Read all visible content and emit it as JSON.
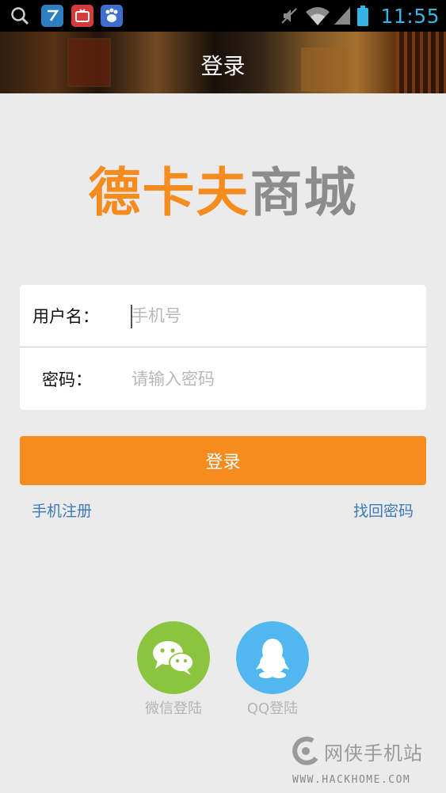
{
  "status_bar": {
    "time": "11:55",
    "icons": [
      "search-icon",
      "app-icon-1",
      "tv-app-icon",
      "baidu-icon",
      "mute-icon",
      "wifi-icon",
      "signal-icon",
      "battery-icon"
    ],
    "clock_color": "#34b5e5"
  },
  "header": {
    "title": "登录"
  },
  "logo": {
    "part1": "德卡夫",
    "part2": "商城",
    "color_primary": "#f68b1e",
    "color_secondary": "#8c8c8c"
  },
  "form": {
    "username_label": "用户名：",
    "username_placeholder": "手机号",
    "username_value": "",
    "password_label": "密码：",
    "password_placeholder": "请输入密码",
    "password_value": ""
  },
  "actions": {
    "login_label": "登录",
    "register_label": "手机注册",
    "forgot_label": "找回密码"
  },
  "social": {
    "wechat_label": "微信登陆",
    "qq_label": "QQ登陆"
  },
  "watermark": {
    "text": "网侠手机站",
    "url": "WWW.HACKHOME.COM"
  },
  "colors": {
    "accent": "#f68b1e",
    "link": "#3d7ab8",
    "wechat": "#8bc53f",
    "qq": "#53b7ef"
  }
}
